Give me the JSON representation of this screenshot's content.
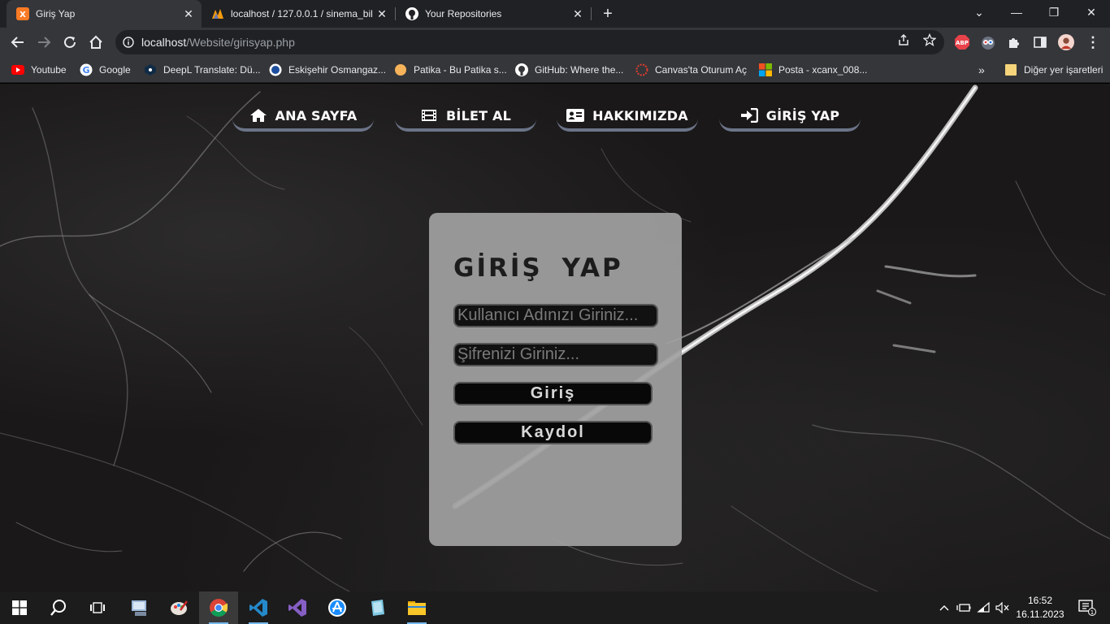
{
  "browser": {
    "tabs": [
      {
        "title": "Giriş Yap",
        "active": true
      },
      {
        "title": "localhost / 127.0.0.1 / sinema_bil",
        "active": false
      },
      {
        "title": "Your Repositories",
        "active": false
      }
    ],
    "url_host": "localhost",
    "url_path": "/Website/girisyap.php",
    "bookmarks": [
      {
        "label": "Youtube",
        "icon": "youtube-icon"
      },
      {
        "label": "Google",
        "icon": "google-icon"
      },
      {
        "label": "DeepL Translate: Dü...",
        "icon": "deepl-icon"
      },
      {
        "label": "Eskişehir Osmangaz...",
        "icon": "university-icon"
      },
      {
        "label": "Patika - Bu Patika s...",
        "icon": "patika-icon"
      },
      {
        "label": "GitHub: Where the...",
        "icon": "github-icon"
      },
      {
        "label": "Canvas'ta Oturum Aç",
        "icon": "canvas-icon"
      },
      {
        "label": "Posta - xcanx_008...",
        "icon": "outlook-icon"
      }
    ],
    "other_bookmarks": "Diğer yer işaretleri",
    "more_bookmarks": "»"
  },
  "site": {
    "nav": [
      {
        "label": "ANA SAYFA",
        "icon": "home-icon"
      },
      {
        "label": "BİLET AL",
        "icon": "film-icon"
      },
      {
        "label": "HAKKIMIZDA",
        "icon": "id-card-icon"
      },
      {
        "label": "GİRİŞ YAP",
        "icon": "sign-in-icon"
      }
    ],
    "login": {
      "title": "GİRİŞ YAP",
      "username_placeholder": "Kullanıcı Adınızı Giriniz...",
      "password_placeholder": "Şifrenizi Giriniz...",
      "login_button": "Giriş",
      "register_button": "Kaydol"
    }
  },
  "taskbar": {
    "time": "16:52",
    "date": "16.11.2023",
    "notification_count": "1"
  }
}
